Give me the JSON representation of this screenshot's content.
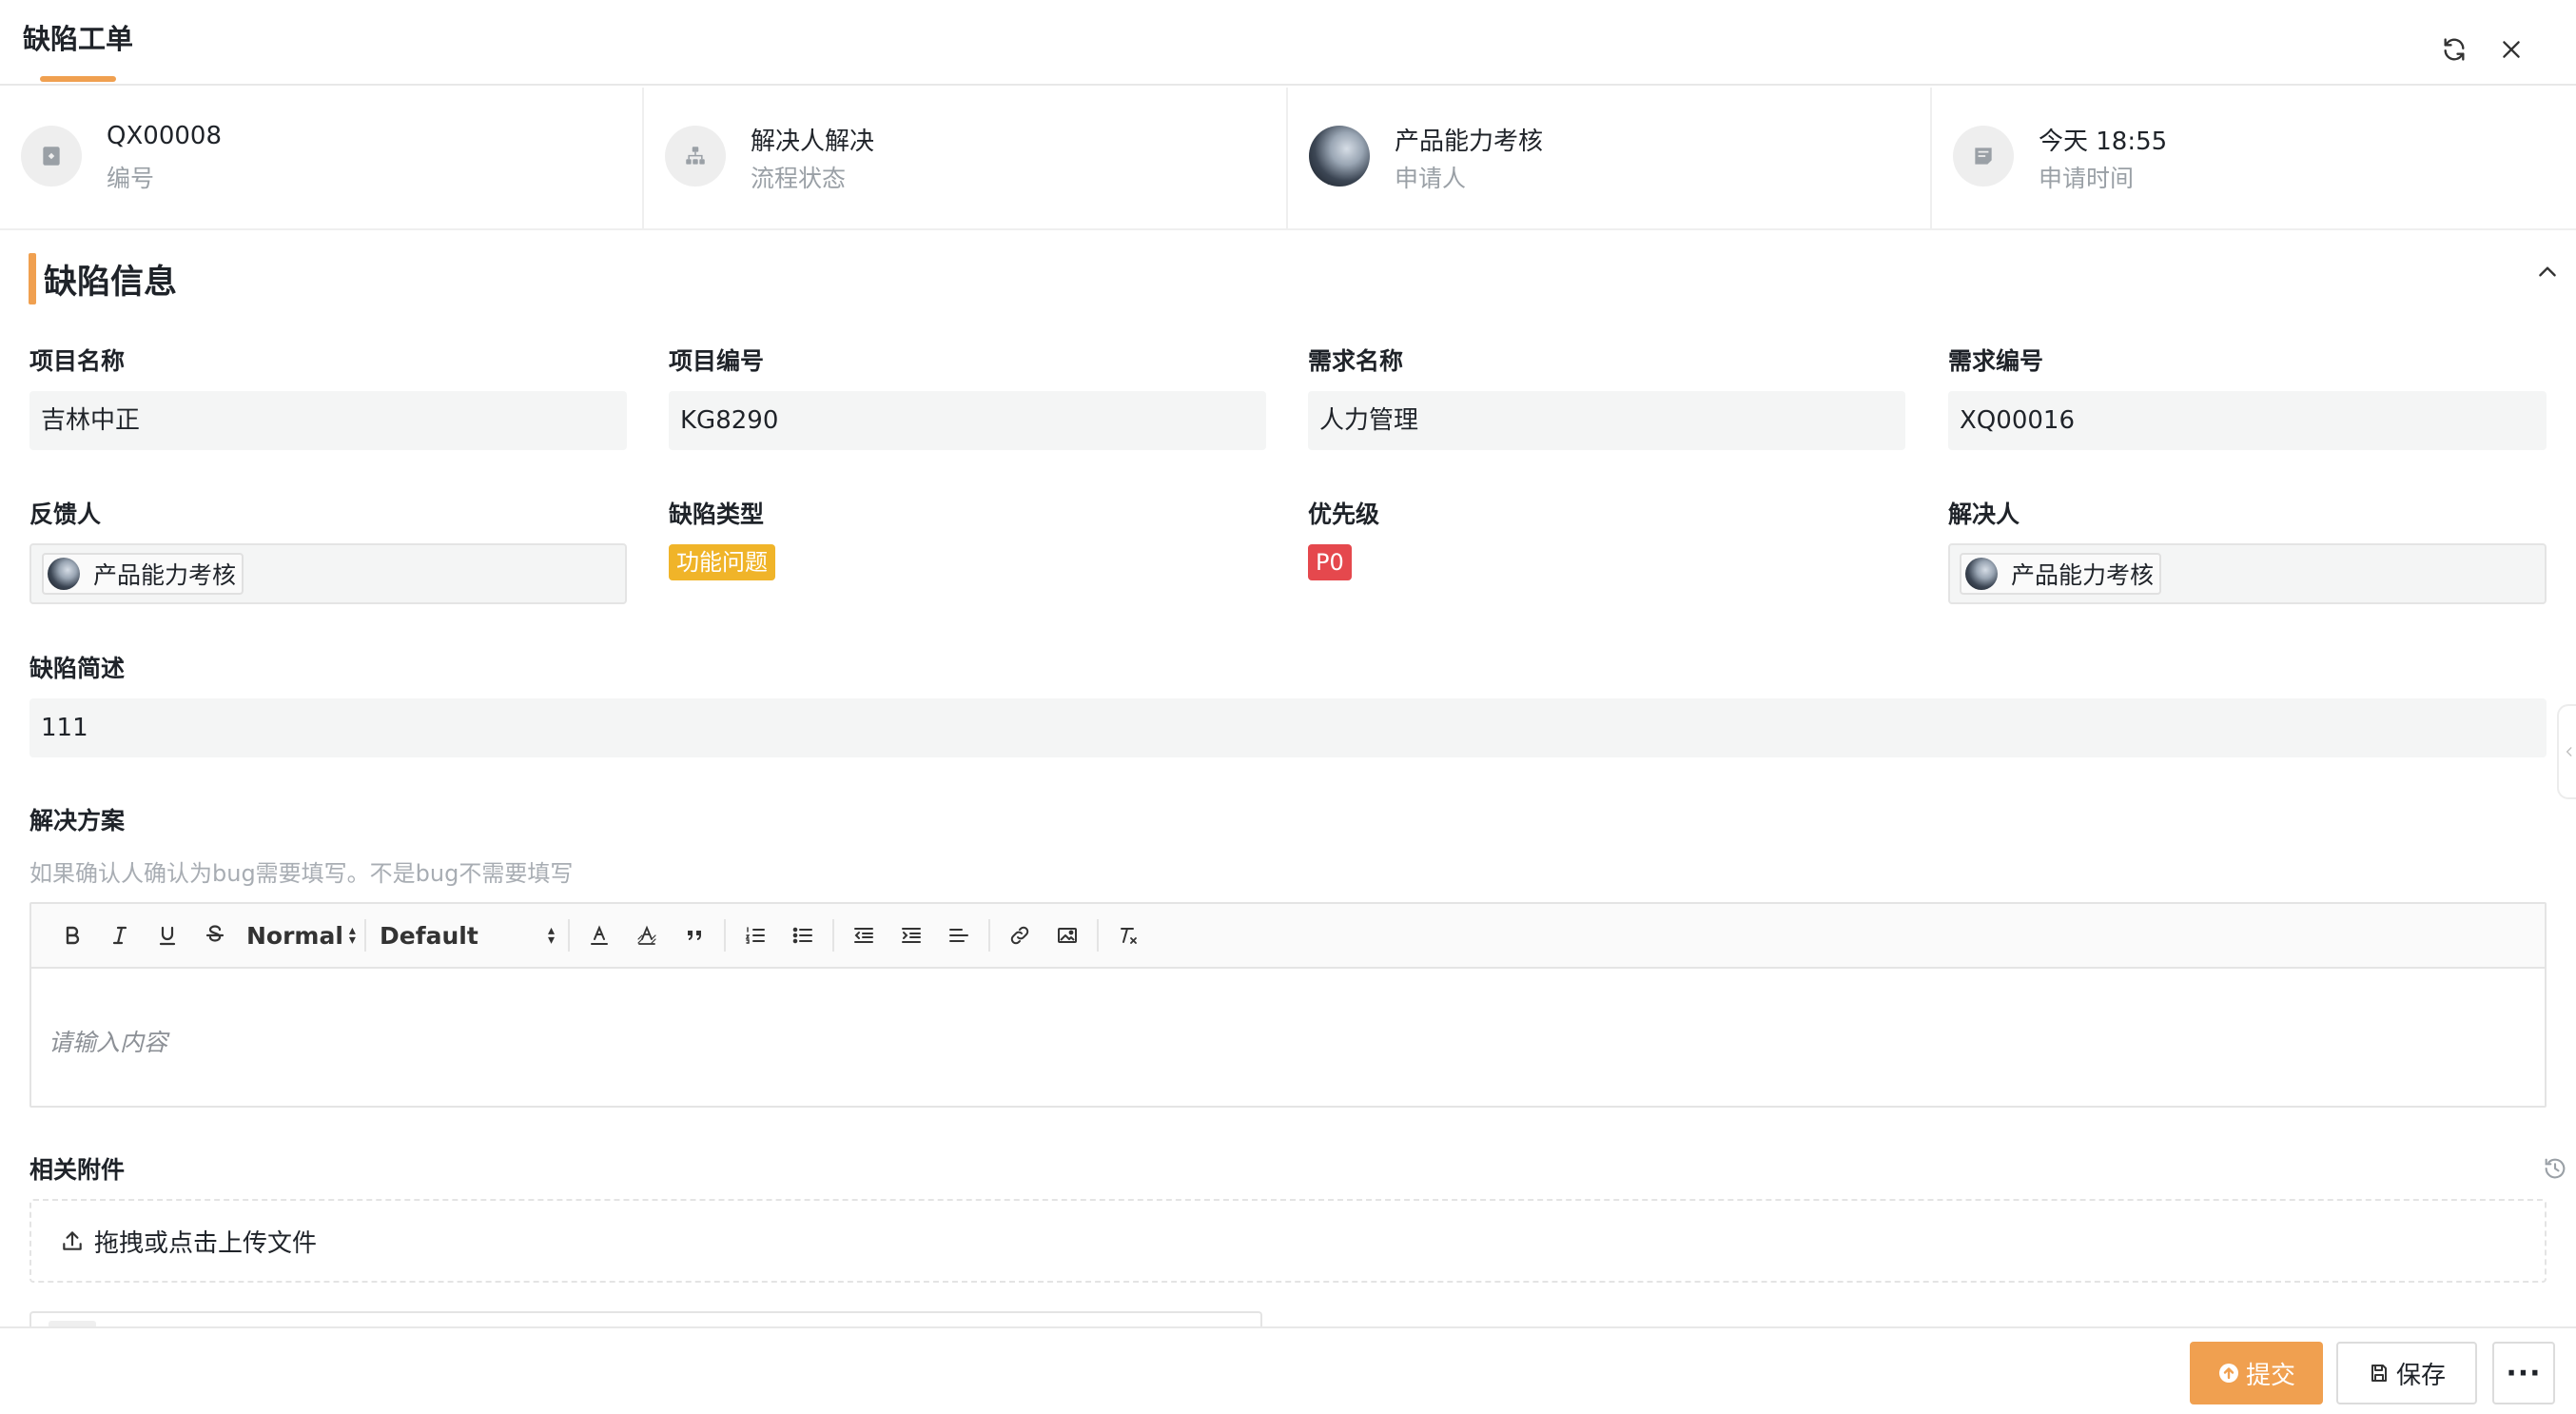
{
  "header": {
    "title": "缺陷工单",
    "refresh_icon": "refresh-icon",
    "close_icon": "close-icon"
  },
  "info": [
    {
      "value": "QX00008",
      "label": "编号",
      "icon": "bookmark-icon"
    },
    {
      "value": "解决人解决",
      "label": "流程状态",
      "icon": "hierarchy-icon"
    },
    {
      "value": "产品能力考核",
      "label": "申请人",
      "icon": "avatar"
    },
    {
      "value": "今天 18:55",
      "label": "申请时间",
      "icon": "note-icon"
    }
  ],
  "section": {
    "title": "缺陷信息"
  },
  "fields": {
    "project_name": {
      "label": "项目名称",
      "value": "吉林中正"
    },
    "project_code": {
      "label": "项目编号",
      "value": "KG8290"
    },
    "requirement_name": {
      "label": "需求名称",
      "value": "人力管理"
    },
    "requirement_code": {
      "label": "需求编号",
      "value": "XQ00016"
    },
    "reporter": {
      "label": "反馈人",
      "value": "产品能力考核"
    },
    "defect_type": {
      "label": "缺陷类型",
      "value": "功能问题",
      "color": "#f0b429"
    },
    "priority": {
      "label": "优先级",
      "value": "P0",
      "color": "#e5484d"
    },
    "resolver": {
      "label": "解决人",
      "value": "产品能力考核"
    },
    "summary": {
      "label": "缺陷简述",
      "value": "111"
    },
    "solution": {
      "label": "解决方案",
      "hint": "如果确认人确认为bug需要填写。不是bug不需要填写",
      "placeholder": "请输入内容",
      "toolbar": {
        "header_select": "Normal",
        "font_select": "Default"
      }
    },
    "attachments": {
      "label": "相关附件",
      "upload_text": "拖拽或点击上传文件"
    }
  },
  "footer": {
    "submit_label": "提交",
    "save_label": "保存",
    "more_label": "···"
  },
  "colors": {
    "accent": "#f0a050",
    "tag_warning": "#f0b429",
    "tag_danger": "#e5484d"
  }
}
